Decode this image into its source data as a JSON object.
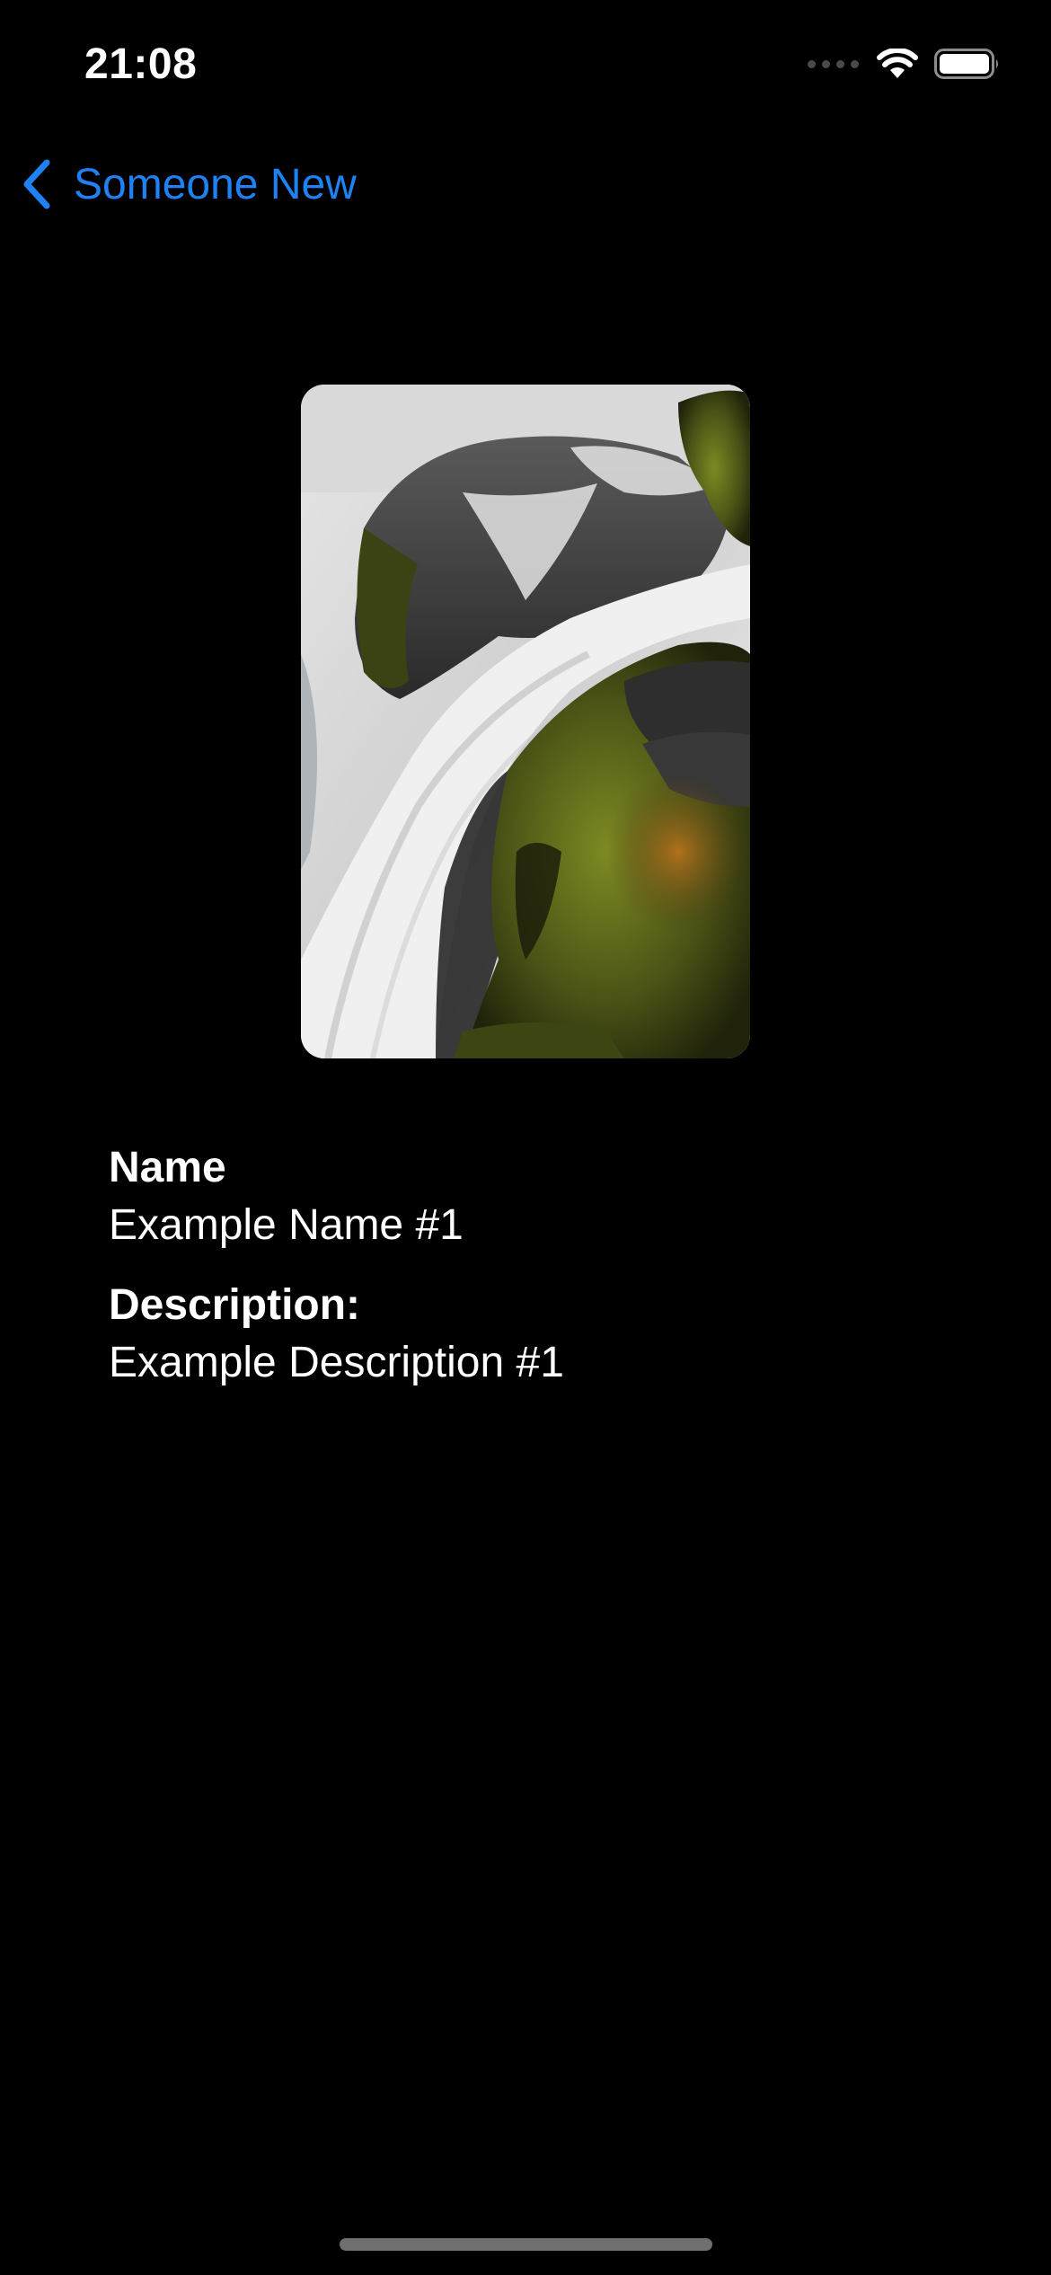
{
  "status_bar": {
    "time": "21:08",
    "icons": [
      "cellular-signal-icon",
      "wifi-icon",
      "battery-icon"
    ]
  },
  "navigation": {
    "back_label": "Someone New",
    "back_icon": "chevron-left-icon"
  },
  "colors": {
    "accent": "#1e82f5",
    "background": "#000000",
    "text": "#ffffff"
  },
  "details": {
    "name_label": "Name",
    "name_value": "Example Name #1",
    "description_label": "Description:",
    "description_value": "Example Description #1"
  }
}
